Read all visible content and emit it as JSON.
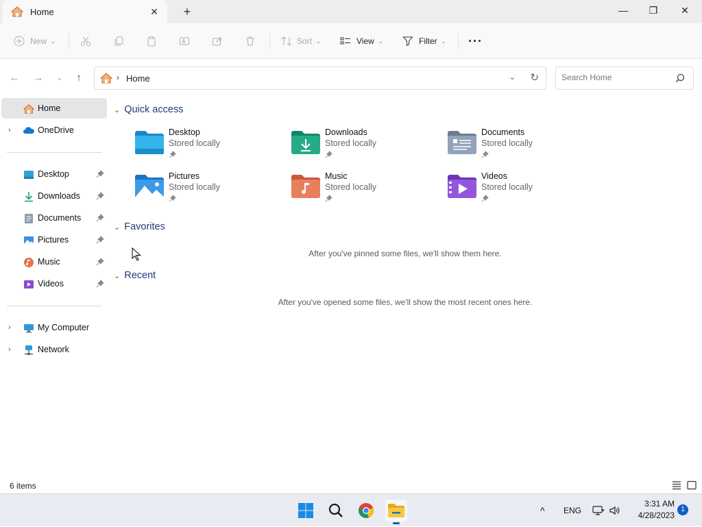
{
  "window": {
    "tab_title": "Home",
    "close_tab_glyph": "✕",
    "new_tab_glyph": "+",
    "minimize_glyph": "—",
    "maximize_glyph": "❐",
    "close_glyph": "✕"
  },
  "toolbar": {
    "new_label": "New",
    "sort_label": "Sort",
    "view_label": "View",
    "filter_label": "Filter",
    "more_glyph": "···"
  },
  "address": {
    "crumb": "Home",
    "separator": "›"
  },
  "search": {
    "placeholder": "Search Home"
  },
  "sidebar": {
    "home": "Home",
    "onedrive": "OneDrive",
    "pinned": [
      {
        "label": "Desktop",
        "icon": "desktop-icon"
      },
      {
        "label": "Downloads",
        "icon": "downloads-icon"
      },
      {
        "label": "Documents",
        "icon": "documents-icon"
      },
      {
        "label": "Pictures",
        "icon": "pictures-icon"
      },
      {
        "label": "Music",
        "icon": "music-icon"
      },
      {
        "label": "Videos",
        "icon": "videos-icon"
      }
    ],
    "my_computer": "My Computer",
    "network": "Network"
  },
  "main": {
    "quick_access_title": "Quick access",
    "quick_access": [
      {
        "name": "Desktop",
        "sub": "Stored locally"
      },
      {
        "name": "Downloads",
        "sub": "Stored locally"
      },
      {
        "name": "Documents",
        "sub": "Stored locally"
      },
      {
        "name": "Pictures",
        "sub": "Stored locally"
      },
      {
        "name": "Music",
        "sub": "Stored locally"
      },
      {
        "name": "Videos",
        "sub": "Stored locally"
      }
    ],
    "favorites_title": "Favorites",
    "favorites_empty": "After you've pinned some files, we'll show them here.",
    "recent_title": "Recent",
    "recent_empty": "After you've opened some files, we'll show the most recent ones here."
  },
  "status": {
    "count": "6 items"
  },
  "taskbar": {
    "lang": "ENG",
    "time": "3:31 AM",
    "date": "4/28/2023",
    "notifications": "1"
  },
  "colors": {
    "accent": "#0e5fc4",
    "section_title": "#1f3f75",
    "home_icon": "#e07b39"
  }
}
